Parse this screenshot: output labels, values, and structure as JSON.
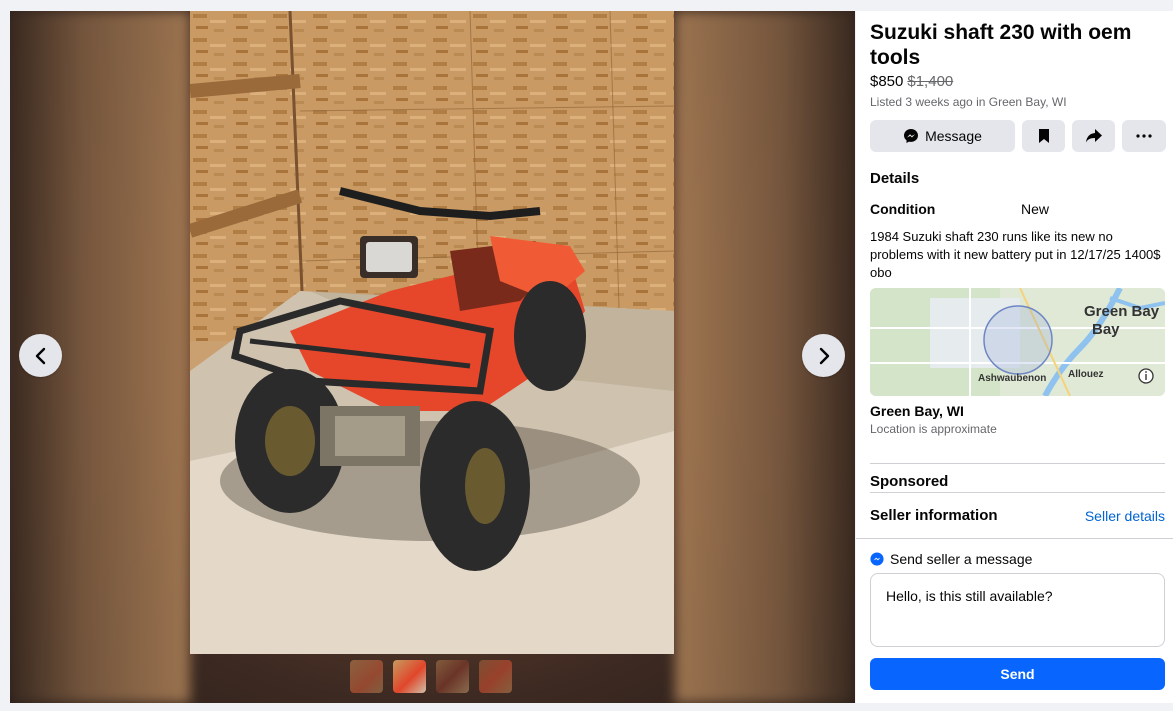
{
  "listing": {
    "title": "Suzuki shaft 230 with oem tools",
    "price": "$850",
    "original_price": "$1,400",
    "listed": "Listed 3 weeks ago in Green Bay, WI"
  },
  "actions": {
    "message_label": "Message"
  },
  "details": {
    "heading": "Details",
    "condition_label": "Condition",
    "condition_value": "New",
    "description": "1984 Suzuki shaft 230 runs like its new no problems with it new battery put in 12/17/25 1400$ obo"
  },
  "map": {
    "city_label": "Green Bay",
    "suburb_1": "Ashwaubenon",
    "suburb_2": "Allouez"
  },
  "location": {
    "name": "Green Bay, WI",
    "note": "Location is approximate"
  },
  "sponsored": "Sponsored",
  "seller": {
    "heading": "Seller information",
    "link": "Seller details"
  },
  "message": {
    "heading": "Send seller a message",
    "value": "Hello, is this still available?",
    "send_label": "Send"
  },
  "colors": {
    "accent": "#0866ff",
    "link": "#0064d1",
    "button_bg": "#e4e6eb"
  },
  "icons": [
    "chevron-left-icon",
    "chevron-right-icon",
    "messenger-icon",
    "bookmark-icon",
    "share-icon",
    "more-icon",
    "info-icon"
  ]
}
